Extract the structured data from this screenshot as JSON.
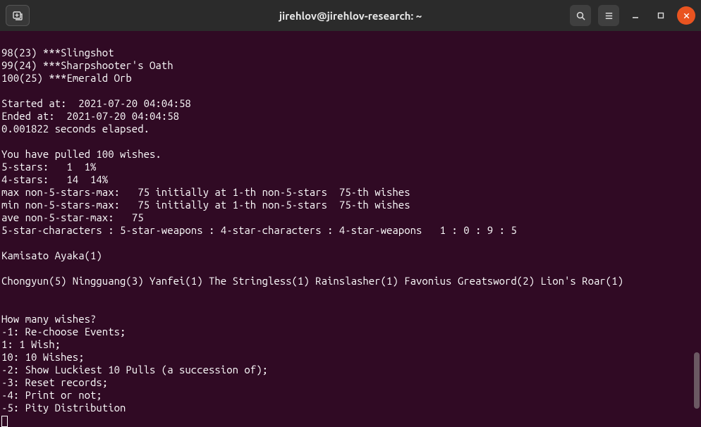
{
  "titlebar": {
    "title": "jirehlov@jirehlov-research: ~"
  },
  "output": {
    "pulls": [
      "98(23) ***Slingshot",
      "99(24) ***Sharpshooter's Oath",
      "100(25) ***Emerald Orb"
    ],
    "blank1": "",
    "started": "Started at:  2021-07-20 04:04:58",
    "ended": "Ended at:  2021-07-20 04:04:58",
    "elapsed": "0.001822 seconds elapsed.",
    "blank2": "",
    "total": "You have pulled 100 wishes.",
    "five": "5-stars:   1  1%",
    "four": "4-stars:   14  14%",
    "maxn": "max non-5-stars-max:   75 initially at 1-th non-5-stars  75-th wishes",
    "minn": "min non-5-stars-max:   75 initially at 1-th non-5-stars  75-th wishes",
    "aven": "ave non-5-star-max:   75",
    "ratio": "5-star-characters : 5-star-weapons : 4-star-characters : 4-star-weapons   1 : 0 : 9 : 5",
    "blank3": "",
    "fivechar": "Kamisato Ayaka(1)",
    "blank4": "",
    "fourlist": "Chongyun(5) Ningguang(3) Yanfei(1) The Stringless(1) Rainslasher(1) Favonius Greatsword(2) Lion's Roar(1)",
    "blank5": "",
    "blank6": "",
    "prompt": "How many wishes?",
    "opt_n1": "-1: Re-choose Events;",
    "opt_1": "1: 1 Wish;",
    "opt_10": "10: 10 Wishes;",
    "opt_n2": "-2: Show Luckiest 10 Pulls (a succession of);",
    "opt_n3": "-3: Reset records;",
    "opt_n4": "-4: Print or not;",
    "opt_n5": "-5: Pity Distribution"
  }
}
